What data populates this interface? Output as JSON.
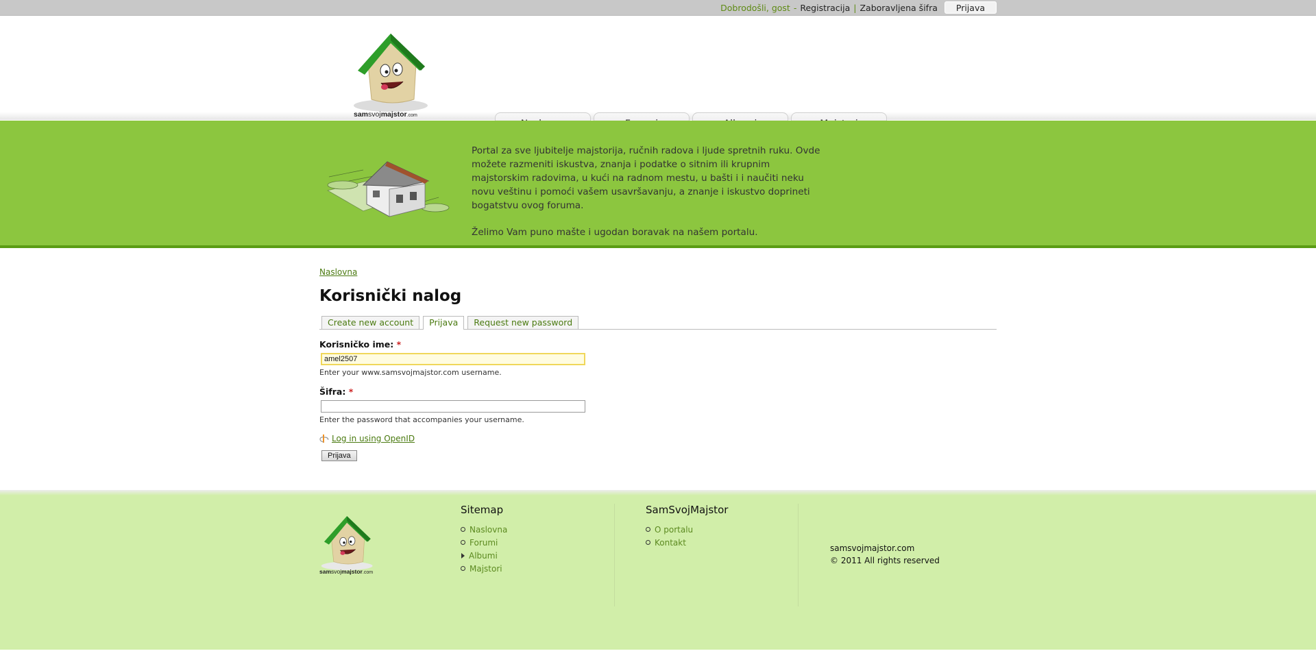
{
  "topbar": {
    "welcome": "Dobrodošli, gost",
    "dash": "-",
    "register": "Registracija",
    "pipe": "|",
    "forgot_password": "Zaboravljena šifra",
    "login_button": "Prijava"
  },
  "logo": {
    "part1": "sam",
    "part2": "svoj",
    "part3": "majstor",
    "part4": ".com"
  },
  "nav": {
    "tabs": [
      {
        "label": "Naslovna"
      },
      {
        "label": "Forumi"
      },
      {
        "label": "Albumi"
      },
      {
        "label": "Majstori"
      }
    ]
  },
  "banner": {
    "paragraph1": "Portal za sve ljubitelje majstorija, ručnih radova i ljude spretnih ruku. Ovde možete razmeniti iskustva, znanja i podatke o sitnim ili krupnim majstorskim radovima, u kući na radnom mestu, u bašti i i naučiti neku novu veštinu i pomoći vašem usavršavanju, a znanje i iskustvo doprineti bogatstvu ovog foruma.",
    "paragraph2": "Želimo Vam puno mašte i ugodan boravak na našem portalu."
  },
  "main": {
    "breadcrumb": "Naslovna",
    "title": "Korisnički nalog",
    "tabs": [
      {
        "label": "Create new account"
      },
      {
        "label": "Prijava"
      },
      {
        "label": "Request new password"
      }
    ],
    "username": {
      "label": "Korisničko ime:",
      "required": "*",
      "value": "amel2507",
      "help": "Enter your www.samsvojmajstor.com username."
    },
    "password": {
      "label": "Šifra:",
      "required": "*",
      "value": "",
      "help": "Enter the password that accompanies your username."
    },
    "openid_link": "Log in using OpenID",
    "submit_label": "Prijava"
  },
  "footer": {
    "sitemap": {
      "heading": "Sitemap",
      "items": [
        {
          "label": "Naslovna"
        },
        {
          "label": "Forumi"
        },
        {
          "label": "Albumi"
        },
        {
          "label": "Majstori"
        }
      ]
    },
    "about": {
      "heading": "SamSvojMajstor",
      "items": [
        {
          "label": "O portalu"
        },
        {
          "label": "Kontakt"
        }
      ]
    },
    "site": "samsvojmajstor.com",
    "copyright": "© 2011 All rights reserved"
  },
  "colors": {
    "banner_green": "#8cc63f",
    "footer_green": "#d1eea9",
    "link_green": "#4a7a10",
    "required_red": "#cc2222",
    "house_roof": "#2e9e2a"
  }
}
